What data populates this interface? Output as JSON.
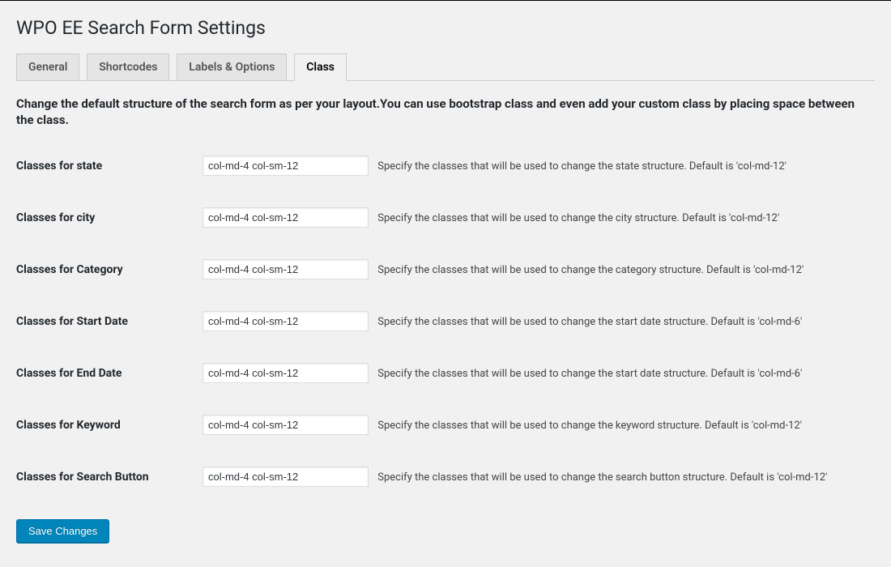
{
  "page": {
    "title": "WPO EE Search Form Settings"
  },
  "tabs": {
    "general": "General",
    "shortcodes": "Shortcodes",
    "labels_options": "Labels & Options",
    "class": "Class"
  },
  "intro": "Change the default structure of the search form as per your layout.You can use bootstrap class and even add your custom class by placing space between the class.",
  "fields": {
    "state": {
      "label": "Classes for state",
      "value": "col-md-4 col-sm-12",
      "hint": "Specify the classes that will be used to change the state structure. Default is 'col-md-12'"
    },
    "city": {
      "label": "Classes for city",
      "value": "col-md-4 col-sm-12",
      "hint": "Specify the classes that will be used to change the city structure. Default is 'col-md-12'"
    },
    "category": {
      "label": "Classes for Category",
      "value": "col-md-4 col-sm-12",
      "hint": "Specify the classes that will be used to change the category structure. Default is 'col-md-12'"
    },
    "start_date": {
      "label": "Classes for Start Date",
      "value": "col-md-4 col-sm-12",
      "hint": "Specify the classes that will be used to change the start date structure. Default is 'col-md-6'"
    },
    "end_date": {
      "label": "Classes for End Date",
      "value": "col-md-4 col-sm-12",
      "hint": "Specify the classes that will be used to change the start date structure. Default is 'col-md-6'"
    },
    "keyword": {
      "label": "Classes for Keyword",
      "value": "col-md-4 col-sm-12",
      "hint": "Specify the classes that will be used to change the keyword structure. Default is 'col-md-12'"
    },
    "search_button": {
      "label": "Classes for Search Button",
      "value": "col-md-4 col-sm-12",
      "hint": "Specify the classes that will be used to change the search button structure. Default is 'col-md-12'"
    }
  },
  "submit": {
    "label": "Save Changes"
  }
}
